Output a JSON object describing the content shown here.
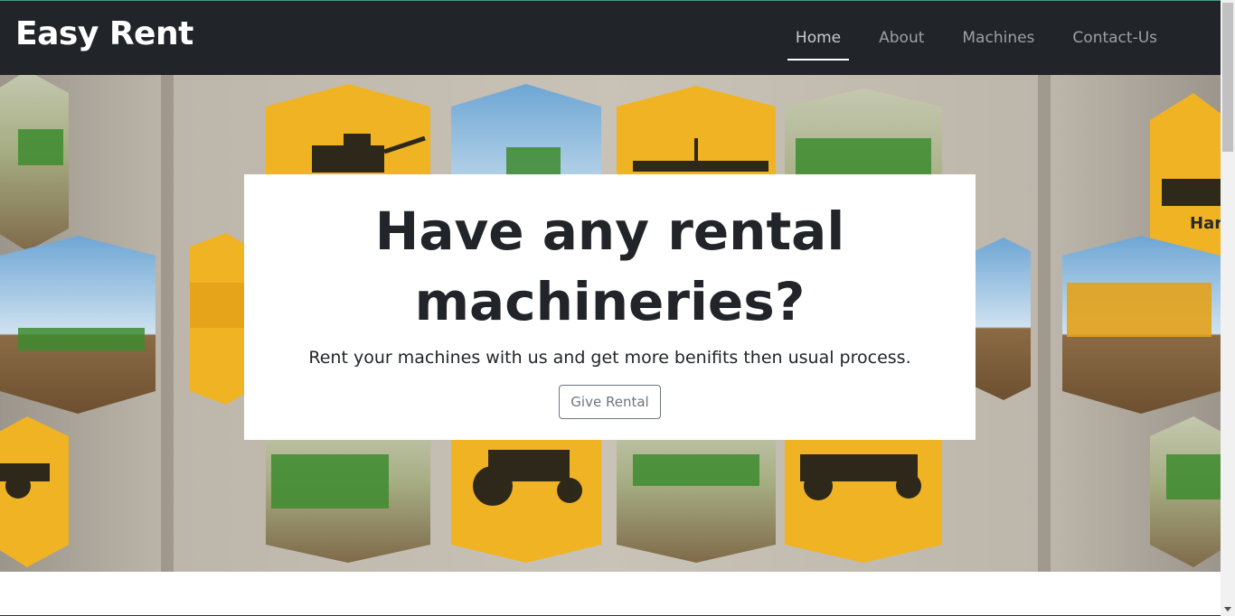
{
  "navbar": {
    "brand": "Easy Rent",
    "links": [
      {
        "label": "Home",
        "active": true
      },
      {
        "label": "About",
        "active": false
      },
      {
        "label": "Machines",
        "active": false
      },
      {
        "label": "Contact-Us",
        "active": false
      }
    ]
  },
  "hero": {
    "background_image": "agricultural-machinery-hexagon-collage",
    "heading": "Have any rental machineries?",
    "heading_line1": "Have any rental",
    "heading_line2": "machineries?",
    "subtitle": "Rent your machines with us and get more benifits then usual process.",
    "button_label": "Give Rental",
    "partial_tile_text": "Har"
  },
  "colors": {
    "navbar_bg": "#212529",
    "accent_hex": "#f0b323",
    "machine_green": "#3d8b2f",
    "text_dark": "#212529",
    "button_border": "#6c757d"
  }
}
